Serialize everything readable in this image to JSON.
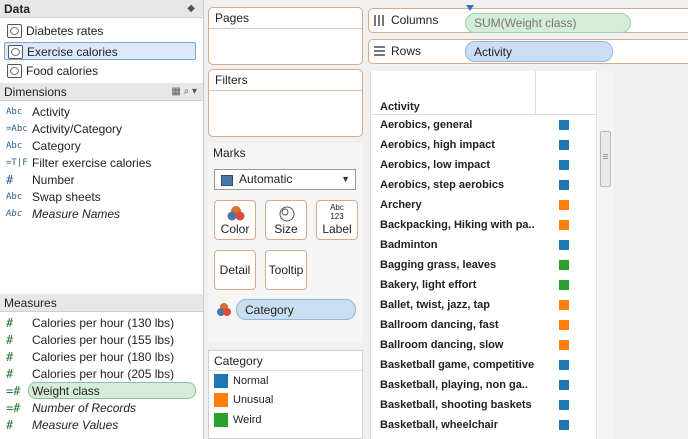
{
  "data_pane": {
    "header": "Data",
    "datasources": [
      {
        "label": "Diabetes rates",
        "selected": false
      },
      {
        "label": "Exercise calories",
        "selected": true
      },
      {
        "label": "Food calories",
        "selected": false
      }
    ]
  },
  "dimensions": {
    "header": "Dimensions",
    "items": [
      {
        "icon": "Abc",
        "label": "Activity"
      },
      {
        "icon": "=Abc",
        "label": "Activity/Category"
      },
      {
        "icon": "Abc",
        "label": "Category"
      },
      {
        "icon": "=T|F",
        "label": "Filter exercise calories"
      },
      {
        "icon": "#",
        "label": "Number"
      },
      {
        "icon": "Abc",
        "label": "Swap sheets"
      },
      {
        "icon": "Abc",
        "label": "Measure Names"
      }
    ]
  },
  "measures": {
    "header": "Measures",
    "items": [
      {
        "icon": "#",
        "label": "Calories per hour (130 lbs)"
      },
      {
        "icon": "#",
        "label": "Calories per hour (155 lbs)"
      },
      {
        "icon": "#",
        "label": "Calories per hour (180 lbs)"
      },
      {
        "icon": "#",
        "label": "Calories per hour (205 lbs)"
      },
      {
        "icon": "=#",
        "label": "Weight class"
      },
      {
        "icon": "=#",
        "label": "Number of Records"
      },
      {
        "icon": "#",
        "label": "Measure Values"
      }
    ]
  },
  "cards": {
    "pages": "Pages",
    "filters": "Filters",
    "marks": "Marks",
    "mark_type": "Automatic",
    "buttons": {
      "color": "Color",
      "size": "Size",
      "label": "Label",
      "detail": "Detail",
      "tooltip": "Tooltip",
      "label_icon": "Abc\n123"
    },
    "color_field": "Category"
  },
  "legend": {
    "title": "Category",
    "items": [
      {
        "label": "Normal",
        "color": "#1f77b4"
      },
      {
        "label": "Unusual",
        "color": "#ff7f0e"
      },
      {
        "label": "Weird",
        "color": "#2ca02c"
      }
    ]
  },
  "shelves": {
    "columns_label": "Columns",
    "columns_pill": "SUM(Weight class)",
    "rows_label": "Rows",
    "rows_pill": "Activity"
  },
  "viz": {
    "header": "Activity",
    "rows": [
      {
        "label": "Aerobics, general",
        "category": "Normal"
      },
      {
        "label": "Aerobics, high impact",
        "category": "Normal"
      },
      {
        "label": "Aerobics, low impact",
        "category": "Normal"
      },
      {
        "label": "Aerobics, step aerobics",
        "category": "Normal"
      },
      {
        "label": "Archery",
        "category": "Unusual"
      },
      {
        "label": "Backpacking, Hiking with pa..",
        "category": "Unusual"
      },
      {
        "label": "Badminton",
        "category": "Normal"
      },
      {
        "label": "Bagging grass, leaves",
        "category": "Weird"
      },
      {
        "label": "Bakery, light effort",
        "category": "Weird"
      },
      {
        "label": "Ballet, twist, jazz, tap",
        "category": "Unusual"
      },
      {
        "label": "Ballroom dancing, fast",
        "category": "Unusual"
      },
      {
        "label": "Ballroom dancing, slow",
        "category": "Unusual"
      },
      {
        "label": "Basketball game, competitive",
        "category": "Normal"
      },
      {
        "label": "Basketball, playing, non ga..",
        "category": "Normal"
      },
      {
        "label": "Basketball, shooting baskets",
        "category": "Normal"
      },
      {
        "label": "Basketball, wheelchair",
        "category": "Normal"
      }
    ]
  }
}
